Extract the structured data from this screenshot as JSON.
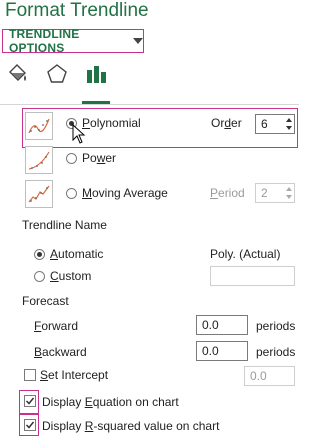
{
  "pane": {
    "title": "Format Trendline"
  },
  "options_dropdown": {
    "label": "TRENDLINE OPTIONS"
  },
  "tabs": {
    "icons": [
      "fill-line-icon",
      "effects-icon",
      "trendline-options-icon"
    ],
    "active": "trendline-options"
  },
  "trend_types": {
    "polynomial": {
      "label_pre": "",
      "label_u": "P",
      "label_post": "olynomial",
      "order_label_pre": "Or",
      "order_label_u": "d",
      "order_label_post": "er",
      "order_value": "6",
      "selected": true
    },
    "power": {
      "label_pre": "Po",
      "label_u": "w",
      "label_post": "er"
    },
    "moving_average": {
      "label_u": "M",
      "label_post": "oving Average",
      "period_label_u": "P",
      "period_label_post": "eriod",
      "period_value": "2"
    }
  },
  "trendline_name": {
    "heading": "Trendline Name",
    "automatic": {
      "label_u": "A",
      "label_post": "utomatic",
      "value": "Poly. (Actual)"
    },
    "custom": {
      "label_u": "C",
      "label_post": "ustom",
      "value": ""
    }
  },
  "forecast": {
    "heading": "Forecast",
    "forward": {
      "label_u": "F",
      "label_post": "orward",
      "value": "0.0",
      "unit": "periods"
    },
    "backward": {
      "label_u": "B",
      "label_post": "ackward",
      "value": "0.0",
      "unit": "periods"
    }
  },
  "set_intercept": {
    "label_u": "S",
    "label_post": "et Intercept",
    "value": "0.0",
    "checked": false
  },
  "display_equation": {
    "label_pre": "Display ",
    "label_u": "E",
    "label_post": "quation on chart",
    "checked": true
  },
  "display_rsquared": {
    "label_pre": "Display ",
    "label_u": "R",
    "label_post": "-squared value on chart",
    "checked": true
  },
  "colors": {
    "accent": "#217346",
    "highlight": "#c8328c"
  }
}
